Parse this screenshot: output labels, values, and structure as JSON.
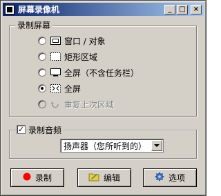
{
  "window": {
    "title": "屏幕录像机",
    "controls": {
      "minimize": "_",
      "maximize": "□",
      "close": "×"
    }
  },
  "capture_group": {
    "title": "录制屏幕",
    "options": [
      {
        "label": "窗口 / 对象",
        "icon": "window-icon",
        "selected": false,
        "disabled": false
      },
      {
        "label": "矩形区域",
        "icon": "rectangle-region-icon",
        "selected": false,
        "disabled": false
      },
      {
        "label": "全屏（不含任务栏）",
        "icon": "monitor-icon",
        "selected": false,
        "disabled": false
      },
      {
        "label": "全屏",
        "icon": "fullscreen-icon",
        "selected": true,
        "disabled": false
      },
      {
        "label": "重复上次区域",
        "icon": "repeat-icon",
        "selected": false,
        "disabled": true
      }
    ]
  },
  "audio_group": {
    "checkbox_label": "录制音频",
    "checked": true,
    "device_value": "扬声器（您所听到的）"
  },
  "buttons": {
    "record": "录制",
    "edit": "编辑",
    "options": "选项"
  },
  "colors": {
    "titlebar_start": "#0a246a",
    "titlebar_end": "#a6caf0",
    "record_red": "#ff0000",
    "face": "#d4d0c8"
  }
}
